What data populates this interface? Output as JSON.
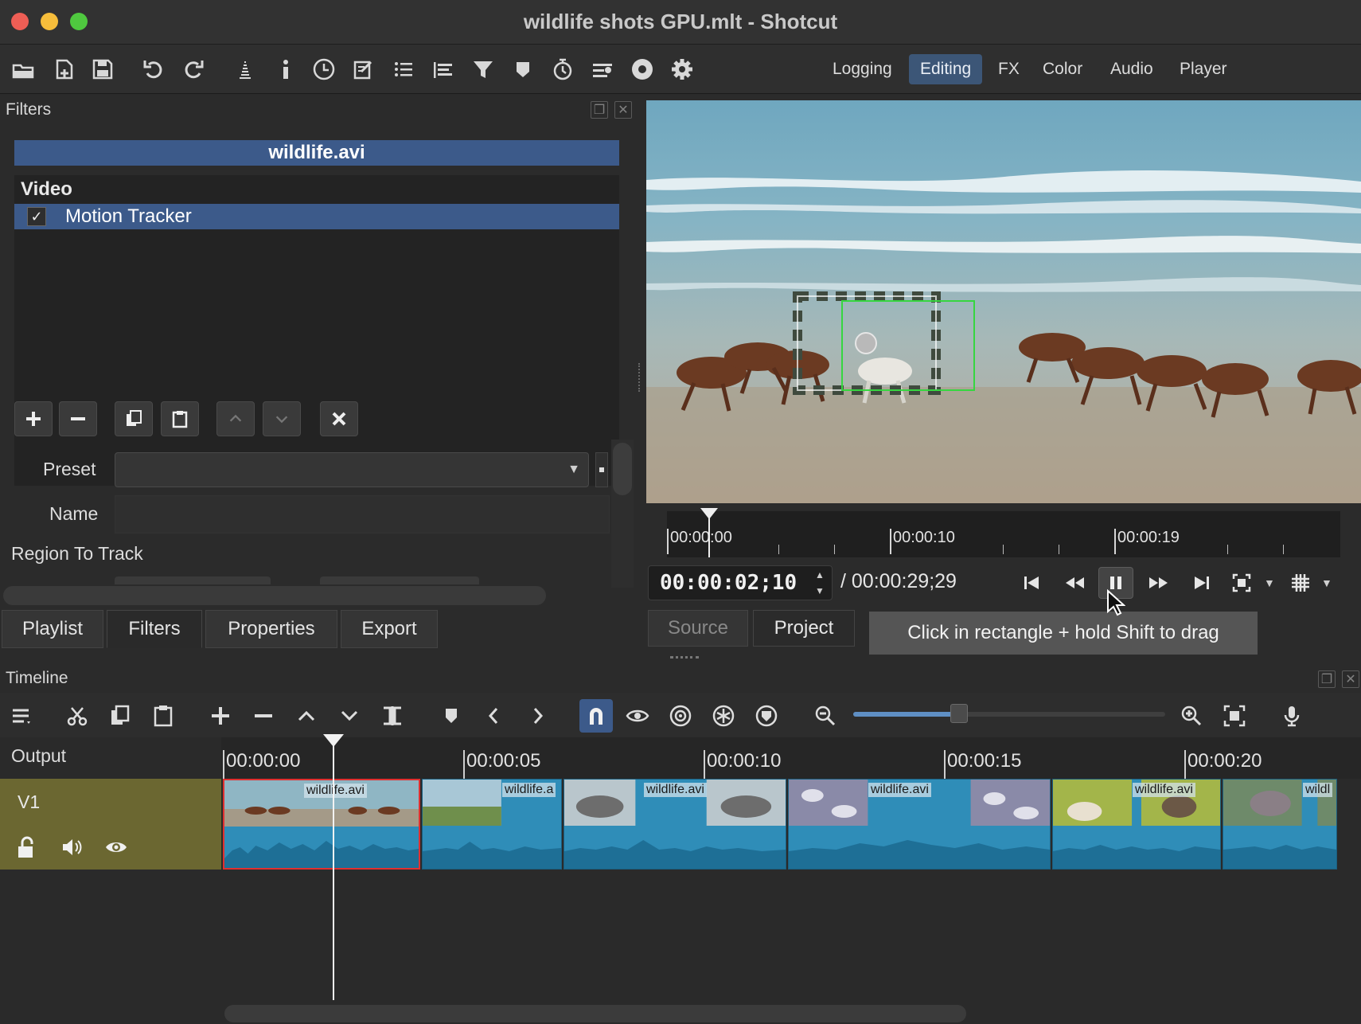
{
  "window": {
    "title": "wildlife shots GPU.mlt - Shotcut"
  },
  "toolbar": {
    "icons": [
      "open-icon",
      "open-other-icon",
      "save-icon",
      "undo-icon",
      "redo-icon",
      "peak-meter-icon",
      "properties-icon",
      "recent-icon",
      "notes-icon",
      "playlist-icon",
      "timeline-icon",
      "filters-icon",
      "markers-icon",
      "keyframes-icon",
      "history-icon",
      "jobs-icon",
      "settings-icon"
    ],
    "layouts": [
      "Logging",
      "Editing",
      "FX",
      "Color",
      "Audio",
      "Player"
    ],
    "active_layout": "Editing"
  },
  "filters_panel": {
    "title": "Filters",
    "clip_name": "wildlife.avi",
    "category": "Video",
    "filters": [
      {
        "label": "Motion Tracker",
        "checked": true,
        "check_glyph": "✓"
      }
    ],
    "preset_label": "Preset",
    "name_label": "Name",
    "section_label": "Region To Track"
  },
  "left_tabs": [
    "Playlist",
    "Filters",
    "Properties",
    "Export"
  ],
  "left_active_tab": "Filters",
  "player": {
    "scrubber_labels": [
      "00:00:00",
      "00:00:10",
      "00:00:19"
    ],
    "timecode": "00:00:02;10",
    "duration": "/ 00:00:29;29",
    "tabs": {
      "source": "Source",
      "project": "Project"
    },
    "tooltip": "Click in rectangle + hold Shift to drag",
    "progress_fraction": 0.079
  },
  "timeline": {
    "title": "Timeline",
    "output_label": "Output",
    "track_name": "V1",
    "ruler_labels": [
      "00:00:00",
      "00:00:05",
      "00:00:10",
      "00:00:15",
      "00:00:20"
    ],
    "clips": [
      {
        "label": "wildlife.avi",
        "selected": true
      },
      {
        "label": "wildlife.a",
        "selected": false
      },
      {
        "label": "wildlife.avi",
        "selected": false
      },
      {
        "label": "wildlife.avi",
        "selected": false
      },
      {
        "label": "wildlife.avi",
        "selected": false
      },
      {
        "label": "wildl",
        "selected": false
      }
    ],
    "zoom_fraction": 0.33,
    "snap_enabled": true
  },
  "colors": {
    "selection": "#3c5a8a",
    "track_header": "#6b6731",
    "clip": "#2f8db8",
    "selected_clip_border": "#e03030"
  }
}
